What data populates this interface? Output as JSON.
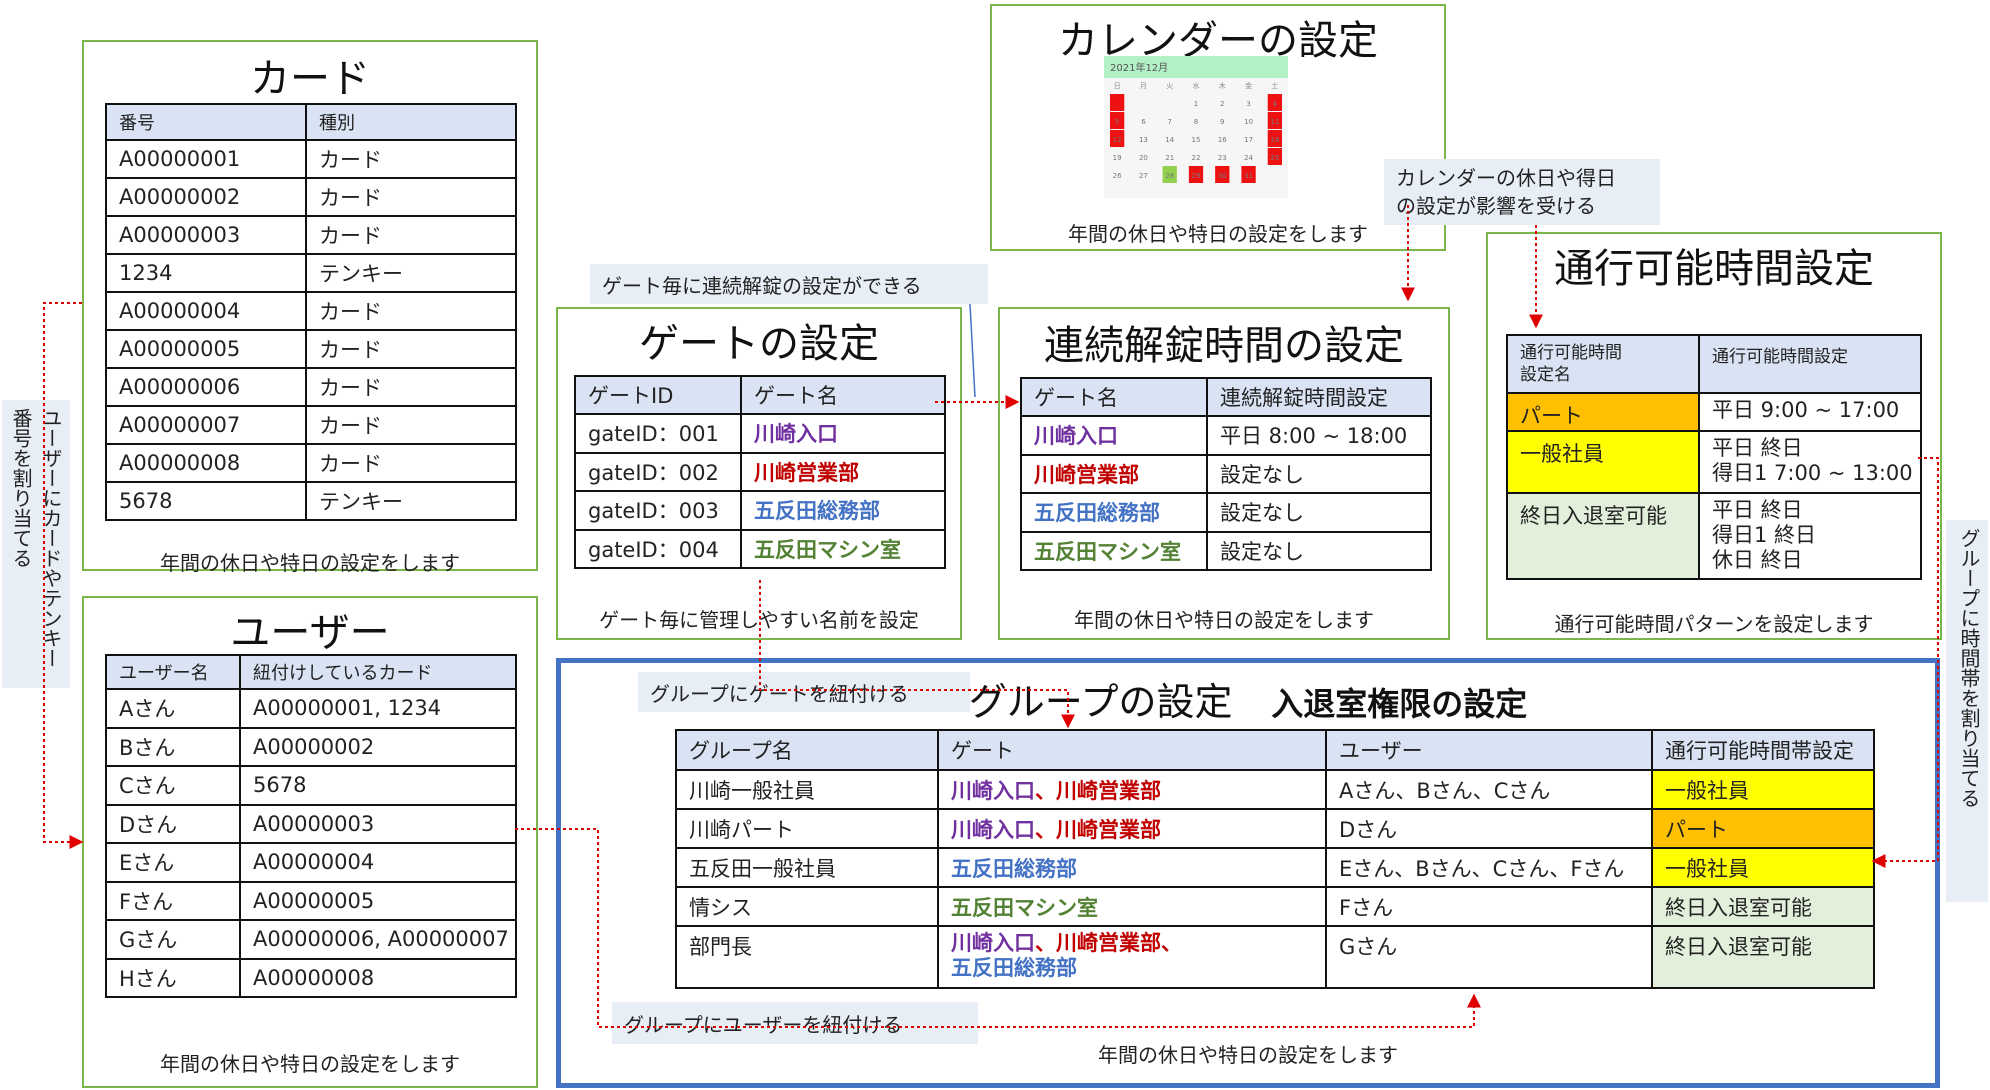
{
  "card": {
    "title": "カード",
    "headers": [
      "番号",
      "種別"
    ],
    "rows": [
      [
        "A00000001",
        "カード"
      ],
      [
        "A00000002",
        "カード"
      ],
      [
        "A00000003",
        "カード"
      ],
      [
        "1234",
        "テンキー"
      ],
      [
        "A00000004",
        "カード"
      ],
      [
        "A00000005",
        "カード"
      ],
      [
        "A00000006",
        "カード"
      ],
      [
        "A00000007",
        "カード"
      ],
      [
        "A00000008",
        "カード"
      ],
      [
        "5678",
        "テンキー"
      ]
    ],
    "footer": "年間の休日や特日の設定をします"
  },
  "user": {
    "title": "ユーザー",
    "headers": [
      "ユーザー名",
      "紐付けしているカード"
    ],
    "rows": [
      [
        "Aさん",
        "A00000001, 1234"
      ],
      [
        "Bさん",
        "A00000002"
      ],
      [
        "Cさん",
        "5678"
      ],
      [
        "Dさん",
        "A00000003"
      ],
      [
        "Eさん",
        "A00000004"
      ],
      [
        "Fさん",
        "A00000005"
      ],
      [
        "Gさん",
        "A00000006, A00000007"
      ],
      [
        "Hさん",
        "A00000008"
      ]
    ],
    "footer": "年間の休日や特日の設定をします"
  },
  "calendar": {
    "title": "カレンダーの設定",
    "month_label": "2021年12月",
    "weekdays": [
      "日",
      "月",
      "火",
      "水",
      "木",
      "金",
      "土"
    ],
    "weeks": [
      [
        "",
        "",
        "",
        "1",
        "2",
        "3",
        "4"
      ],
      [
        "5",
        "6",
        "7",
        "8",
        "9",
        "10",
        "11"
      ],
      [
        "12",
        "13",
        "14",
        "15",
        "16",
        "17",
        "18"
      ],
      [
        "19",
        "20",
        "21",
        "22",
        "23",
        "24",
        "25"
      ],
      [
        "26",
        "27",
        "28",
        "29",
        "30",
        "31",
        ""
      ]
    ],
    "holiday_color": "#ee1111",
    "special_color": "#92d050",
    "footer": "年間の休日や特日の設定をします"
  },
  "gate": {
    "title": "ゲートの設定",
    "headers": [
      "ゲートID",
      "ゲート名"
    ],
    "rows": [
      [
        "gateID：001",
        "川崎入口"
      ],
      [
        "gateID：002",
        "川崎営業部"
      ],
      [
        "gateID：003",
        "五反田総務部"
      ],
      [
        "gateID：004",
        "五反田マシン室"
      ]
    ],
    "footer": "ゲート毎に管理しやすい名前を設定"
  },
  "unlock": {
    "title": "連続解錠時間の設定",
    "headers": [
      "ゲート名",
      "連続解錠時間設定"
    ],
    "rows": [
      [
        "川崎入口",
        "平日 8:00 ~ 18:00"
      ],
      [
        "川崎営業部",
        "設定なし"
      ],
      [
        "五反田総務部",
        "設定なし"
      ],
      [
        "五反田マシン室",
        "設定なし"
      ]
    ],
    "footer": "年間の休日や特日の設定をします"
  },
  "passtime": {
    "title": "通行可能時間設定",
    "headers": [
      "通行可能時間\n設定名",
      "通行可能時間設定"
    ],
    "rows": [
      [
        "パート",
        "平日 9:00 ~ 17:00"
      ],
      [
        "一般社員",
        "平日 終日\n得日1 7:00 ~ 13:00"
      ],
      [
        "終日入退室可能",
        "平日 終日\n得日1 終日\n休日 終日"
      ]
    ],
    "footer": "通行可能時間パターンを設定します"
  },
  "group": {
    "title": "グループの設定",
    "subtitle": "入退室権限の設定",
    "headers": [
      "グループ名",
      "ゲート",
      "ユーザー",
      "通行可能時間帯設定"
    ],
    "rows": [
      {
        "name": "川崎一般社員",
        "gates": [
          "川崎入口",
          "川崎営業部"
        ],
        "users": "Aさん、Bさん、Cさん",
        "time": "一般社員"
      },
      {
        "name": "川崎パート",
        "gates": [
          "川崎入口",
          "川崎営業部"
        ],
        "users": "Dさん",
        "time": "パート"
      },
      {
        "name": "五反田一般社員",
        "gates": [
          "五反田総務部"
        ],
        "users": "Eさん、Bさん、Cさん、Fさん",
        "time": "一般社員"
      },
      {
        "name": "情シス",
        "gates": [
          "五反田マシン室"
        ],
        "users": "Fさん",
        "time": "終日入退室可能"
      },
      {
        "name": "部門長",
        "gates": [
          "川崎入口",
          "川崎営業部",
          "五反田総務部"
        ],
        "users": "Gさん",
        "time": "終日入退室可能"
      }
    ],
    "separator": "、",
    "footer": "年間の休日や特日の設定をします"
  },
  "notes": {
    "gate_unlock": "ゲート毎に連続解錠の設定ができる",
    "calendar_effect": "カレンダーの休日や得日\nの設定が影響を受ける",
    "group_gate": "グループにゲートを紐付ける",
    "group_user": "グループにユーザーを紐付ける",
    "user_card": "ユーザーにカードやテンキー番号を割り当てる",
    "group_time": "グループに時間帯を割り当てる"
  },
  "colors": {
    "panel_border": "#7ab648",
    "group_border": "#4472c4",
    "header_bg": "#dae3f3",
    "note_bg": "#e7eef6",
    "arrow": "#e00000"
  }
}
